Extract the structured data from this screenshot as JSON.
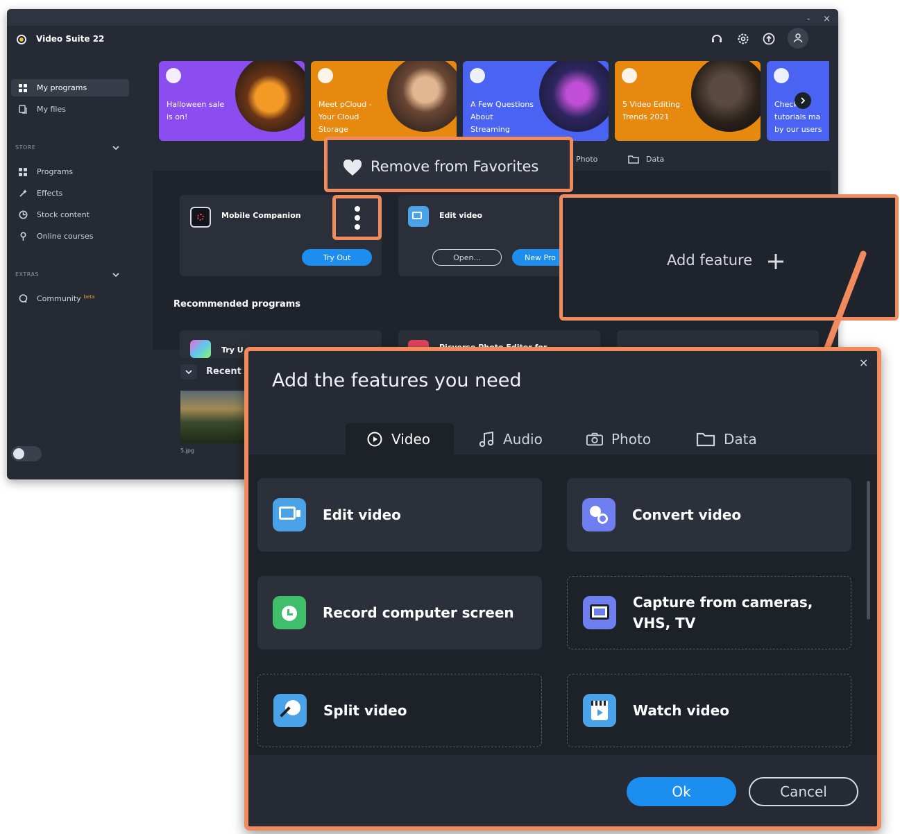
{
  "window": {
    "controls": {
      "minimize": "-",
      "close": "×"
    },
    "app_title": "Video Suite 22"
  },
  "sidebar": {
    "main_items": [
      {
        "label": "My programs",
        "icon": "grid-icon"
      },
      {
        "label": "My files",
        "icon": "files-icon"
      }
    ],
    "store_header": "STORE",
    "store_items": [
      {
        "label": "Programs",
        "icon": "grid-icon"
      },
      {
        "label": "Effects",
        "icon": "wand-icon"
      },
      {
        "label": "Stock content",
        "icon": "clock-icon"
      },
      {
        "label": "Online courses",
        "icon": "pin-icon"
      }
    ],
    "extras_header": "EXTRAS",
    "extras_items": [
      {
        "label": "Community",
        "badge": "beta",
        "icon": "chat-icon"
      }
    ]
  },
  "banners": [
    {
      "text": "Halloween sale\nis on!",
      "color": "#8b4cf0"
    },
    {
      "text": "Meet pCloud -\nYour Cloud\nStorage",
      "color": "#e8890f"
    },
    {
      "text": "A Few Questions\nAbout\nStreaming",
      "color": "#4a63f2"
    },
    {
      "text": "5 Video Editing\nTrends 2021",
      "color": "#e8890f"
    },
    {
      "text": "Check\ntutorials ma\nby our users",
      "color": "#4a63f2"
    }
  ],
  "window_tabs": {
    "photo": "Photo",
    "data": "Data"
  },
  "favorite_popup": {
    "label": "Remove from Favorites"
  },
  "program_cards": [
    {
      "title": "Mobile Companion",
      "button": "Try Out"
    },
    {
      "title": "Edit video",
      "open_button": "Open...",
      "new_button": "New Pro"
    }
  ],
  "add_feature": {
    "label": "Add feature"
  },
  "recommended": {
    "heading": "Recommended programs",
    "items": [
      "Try U",
      "Picverse Photo Editor for"
    ]
  },
  "recent": {
    "label": "Recent",
    "file": "5.jpg"
  },
  "dialog": {
    "title": "Add the features you need",
    "close": "×",
    "tabs": [
      {
        "label": "Video",
        "icon": "play-circle-icon"
      },
      {
        "label": "Audio",
        "icon": "music-note-icon"
      },
      {
        "label": "Photo",
        "icon": "camera-icon"
      },
      {
        "label": "Data",
        "icon": "folder-icon"
      }
    ],
    "features": [
      {
        "label": "Edit video",
        "style": "solid",
        "color": "#4aa3e8"
      },
      {
        "label": "Convert video",
        "style": "solid",
        "color": "#6f7ff0"
      },
      {
        "label": "Record computer screen",
        "style": "solid",
        "color": "#3fbf6a"
      },
      {
        "label": "Capture from cameras,\nVHS, TV",
        "style": "dashed",
        "color": "#6f7ff0"
      },
      {
        "label": "Split video",
        "style": "dashed",
        "color": "#4aa3e8"
      },
      {
        "label": "Watch video",
        "style": "dashed",
        "color": "#4aa3e8"
      }
    ],
    "ok": "Ok",
    "cancel": "Cancel"
  },
  "colors": {
    "accent": "#1c8ef0",
    "highlight": "#f18a5c"
  }
}
